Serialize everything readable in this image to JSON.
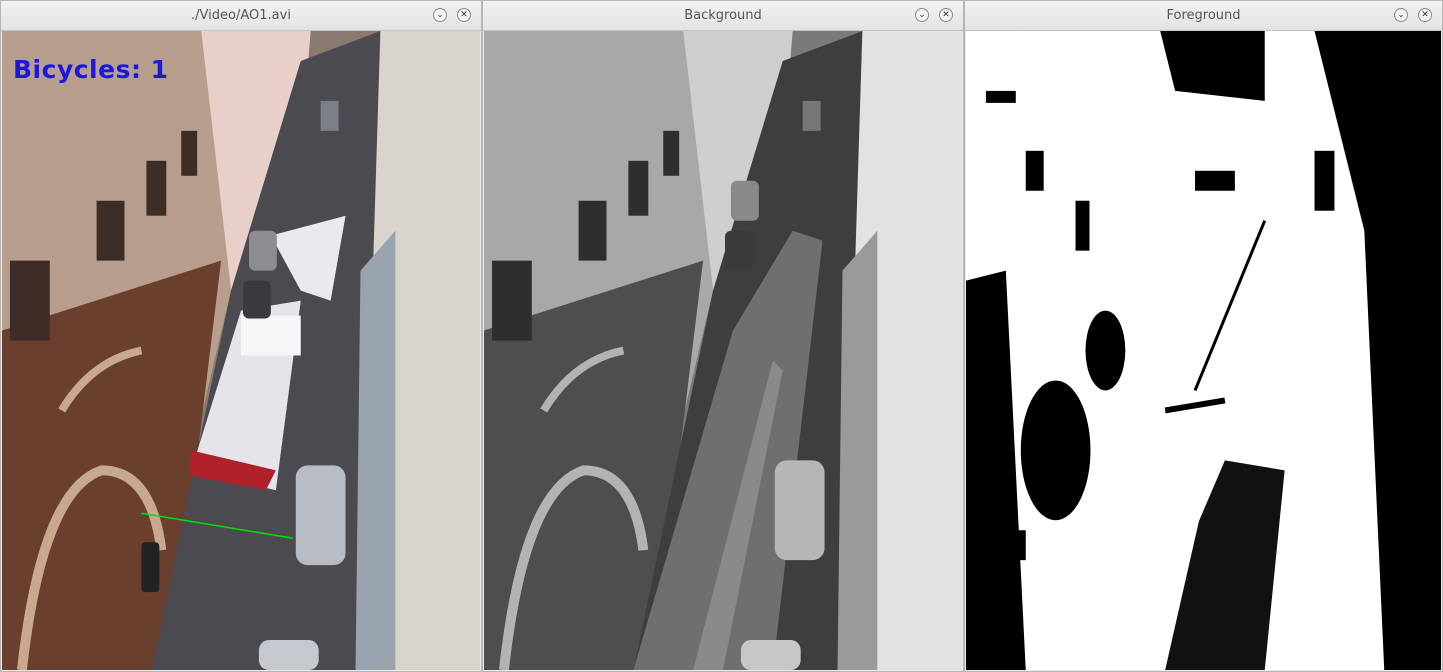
{
  "windows": [
    {
      "title": "./Video/AO1.avi"
    },
    {
      "title": "Background"
    },
    {
      "title": "Foreground"
    }
  ],
  "titlebar": {
    "minimize_glyph": "⌄",
    "close_glyph": "✕"
  },
  "overlay": {
    "text": "Bicycles:  1",
    "color": "#0000ff"
  },
  "counting_line": {
    "color": "#00ff00"
  },
  "icons": [
    "chevron-down-icon",
    "close-icon"
  ]
}
